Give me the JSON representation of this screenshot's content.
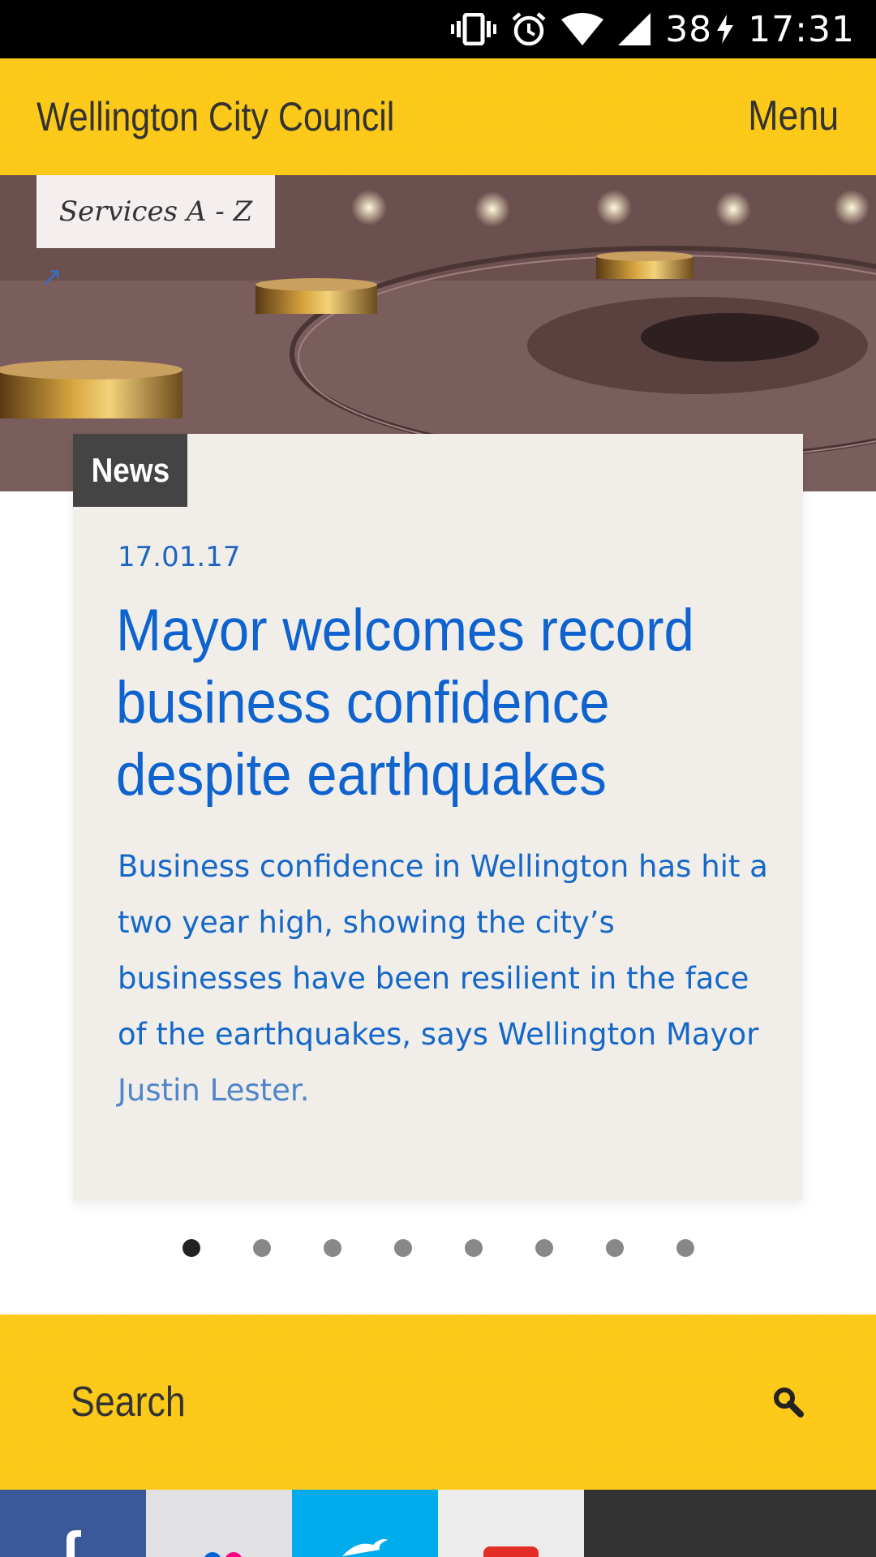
{
  "status_bar": {
    "battery": "38",
    "time": "17:31",
    "icons": [
      "vibrate-icon",
      "alarm-icon",
      "wifi-icon",
      "signal-icon",
      "battery-charging-icon"
    ]
  },
  "header": {
    "title": "Wellington City Council",
    "menu_label": "Menu"
  },
  "hero": {
    "services_label": "Services A - Z",
    "external_icon": "external-link-arrow-icon"
  },
  "news": {
    "badge": "News",
    "date": "17.01.17",
    "title": "Mayor welcomes record business confidence despite earthquakes",
    "summary_main": "Business confidence in Wellington has hit a two year high, showing the city’s businesses have been resilient in the face of the earthquakes, says Wellington Mayor",
    "summary_tail": "Justin Lester."
  },
  "carousel": {
    "count": 8,
    "active_index": 0
  },
  "search": {
    "label": "Search",
    "icon": "search-icon"
  },
  "social": [
    "facebook-icon",
    "flickr-icon",
    "twitter-icon",
    "youtube-icon"
  ],
  "colors": {
    "brand_yellow": "#fdc918",
    "link_blue": "#0e63cf",
    "badge_dark": "#444444"
  }
}
